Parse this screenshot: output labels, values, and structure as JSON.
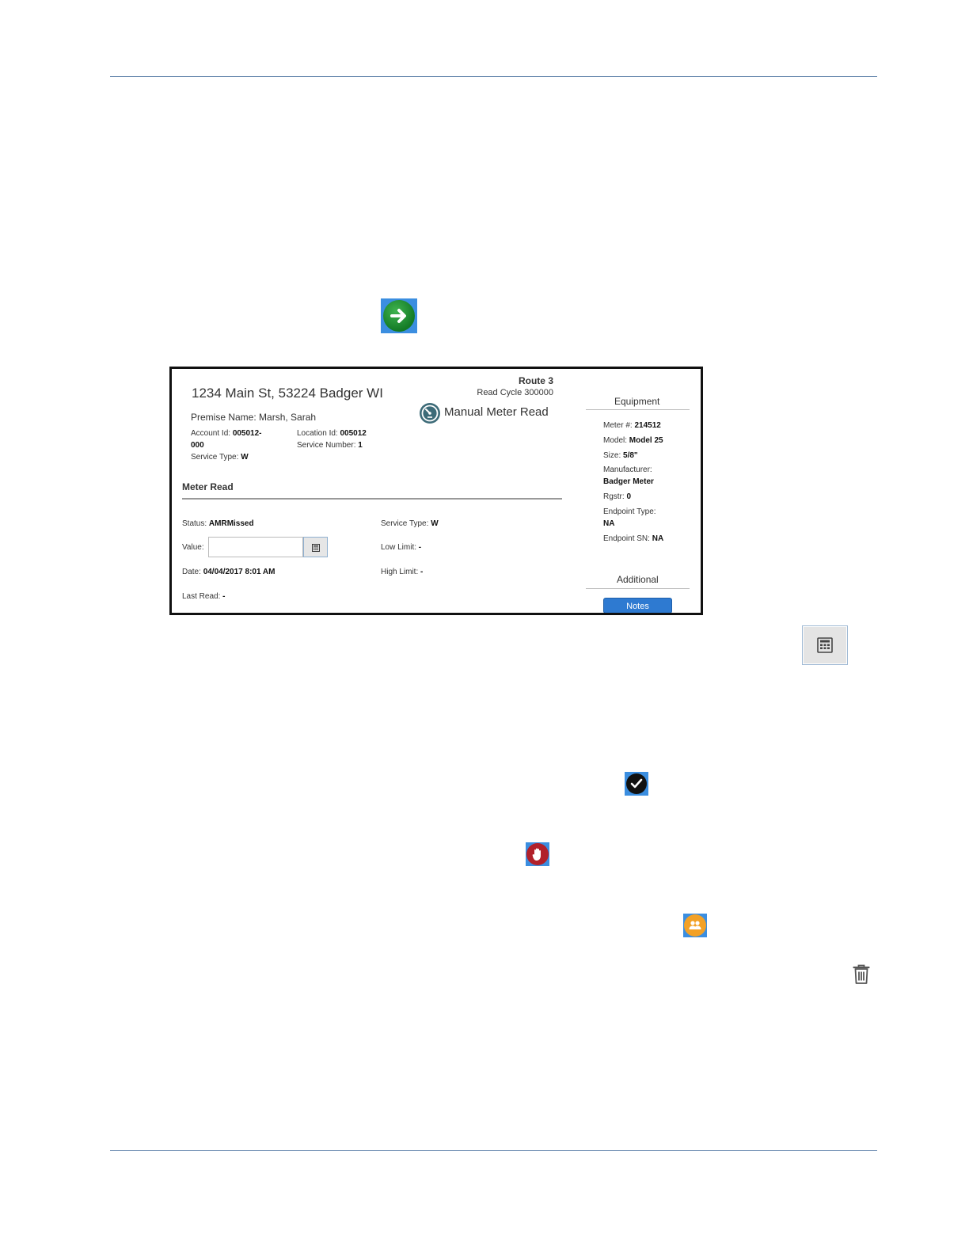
{
  "panel": {
    "address": "1234 Main St, 53224 Badger WI",
    "route": "Route 3",
    "read_cycle": "Read Cycle 300000",
    "read_type": "Manual Meter Read",
    "premise": "Premise Name: Marsh, Sarah",
    "account_label": "Account Id:",
    "account_value_1": "005012-",
    "account_value_2": "000",
    "location_label": "Location Id:",
    "location_value": "005012",
    "service_number_label": "Service Number:",
    "service_number_value": "1",
    "service_type_label": "Service Type:",
    "service_type_value": "W",
    "meter_read_title": "Meter Read",
    "status_label": "Status:",
    "status_value": "AMRMissed",
    "value_label": "Value:",
    "value_input": "",
    "date_label": "Date:",
    "date_value": "04/04/2017 8:01 AM",
    "last_read_label": "Last Read:",
    "last_read_value": "-",
    "service_type2_label": "Service Type:",
    "service_type2_value": "W",
    "low_limit_label": "Low Limit:",
    "low_limit_value": "-",
    "high_limit_label": "High Limit:",
    "high_limit_value": "-"
  },
  "equipment": {
    "heading": "Equipment",
    "meter_label": "Meter #:",
    "meter_value": "214512",
    "model_label": "Model:",
    "model_value": "Model 25",
    "size_label": "Size:",
    "size_value": "5/8\"",
    "manufacturer_label": "Manufacturer:",
    "manufacturer_value": "Badger Meter",
    "rgstr_label": "Rgstr:",
    "rgstr_value": "0",
    "endpoint_type_label": "Endpoint Type:",
    "endpoint_type_value": "NA",
    "endpoint_sn_label": "Endpoint SN:",
    "endpoint_sn_value": "NA",
    "additional_heading": "Additional",
    "notes_label": "Notes"
  },
  "icons": {
    "go": "arrow-right-circle-icon",
    "calculator": "calculator-icon",
    "check": "check-circle-icon",
    "hand": "stop-hand-icon",
    "people": "people-icon",
    "trash": "trash-icon",
    "meter": "meter-gauge-icon"
  },
  "colors": {
    "rule": "#5b7fa8",
    "go_green": "#1f8f33",
    "highlight_blue": "#3b8ee0",
    "stop_red": "#b1202a",
    "people_orange": "#f3a126",
    "notes_blue": "#2e7ad1"
  }
}
